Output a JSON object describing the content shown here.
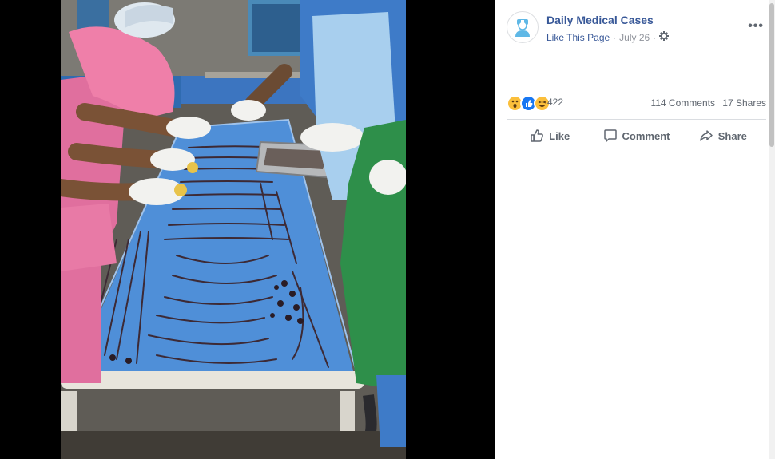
{
  "post": {
    "page_name": "Daily Medical Cases",
    "like_page": "Like This Page",
    "separator": "·",
    "date": "July 26",
    "settings_icon": "gear-icon",
    "more_icon": "ellipsis-icon",
    "more_label": "•••",
    "avatar_icon": "doctor-avatar"
  },
  "reactions": {
    "icons": [
      "wow-emoji",
      "like-thumb",
      "haha-emoji"
    ],
    "count": "422",
    "comments": "114 Comments",
    "shares": "17 Shares"
  },
  "actions": {
    "like": "Like",
    "comment": "Comment",
    "share": "Share"
  },
  "photo": {
    "description": "photo-of-jewelry-on-stretcher"
  },
  "colors": {
    "link": "#385898",
    "meta": "#90949c",
    "action_text": "#606770",
    "stretcher": "#4f8fd8"
  }
}
